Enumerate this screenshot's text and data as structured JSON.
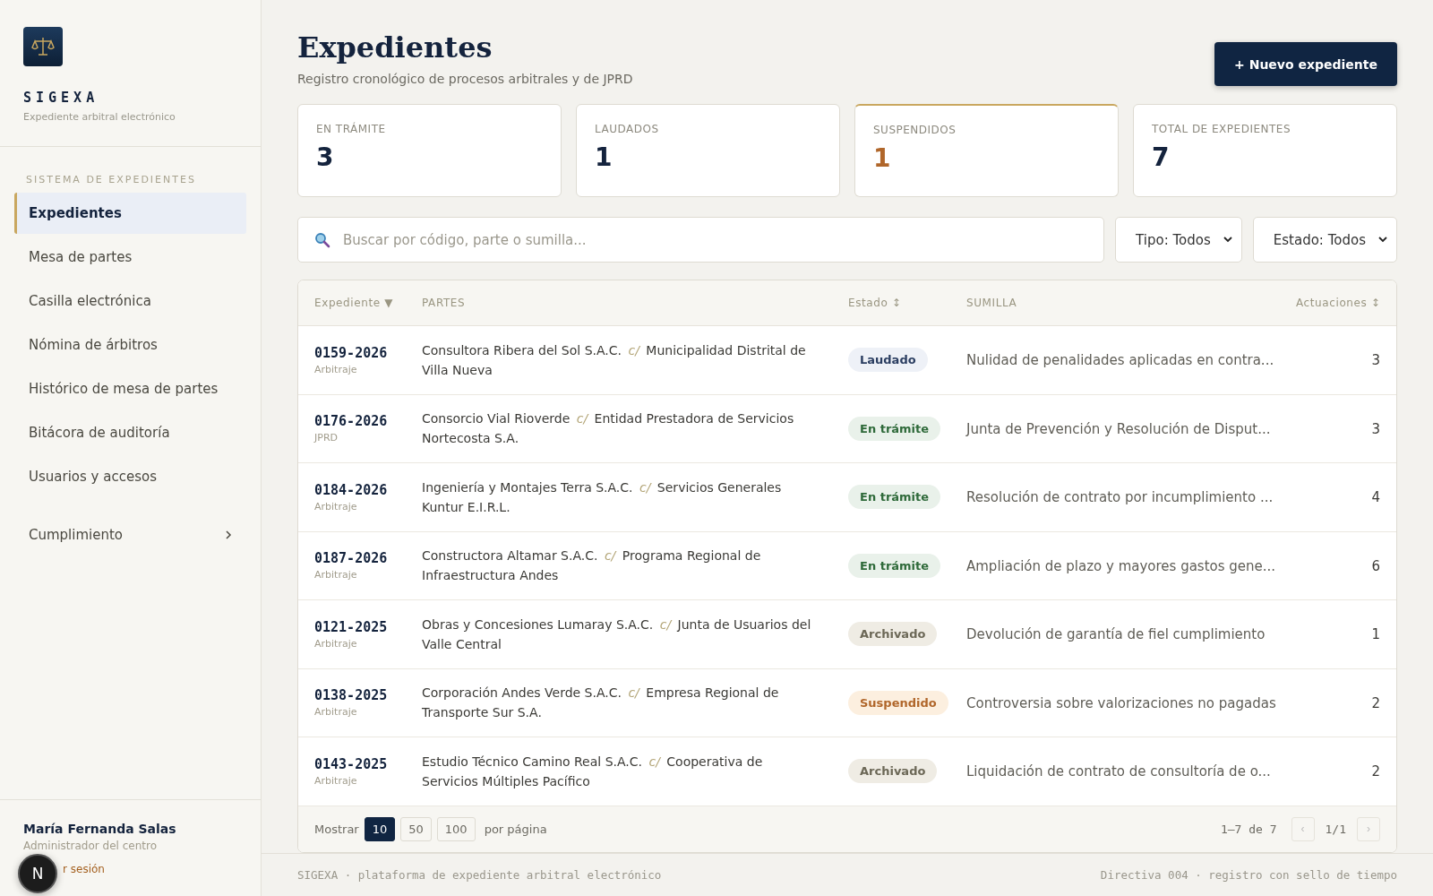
{
  "brand": {
    "name": "SIGEXA",
    "tagline": "Expediente arbitral electrónico"
  },
  "sidebar": {
    "section": "SISTEMA DE EXPEDIENTES",
    "items": [
      {
        "label": "Expedientes",
        "selected": true,
        "kind": "link"
      },
      {
        "label": "Mesa de partes",
        "selected": false,
        "kind": "link"
      },
      {
        "label": "Casilla electrónica",
        "selected": false,
        "kind": "link"
      },
      {
        "label": "Nómina de árbitros",
        "selected": false,
        "kind": "link"
      },
      {
        "label": "Histórico de mesa de partes",
        "selected": false,
        "kind": "link"
      },
      {
        "label": "Bitácora de auditoría",
        "selected": false,
        "kind": "link"
      },
      {
        "label": "Usuarios y accesos",
        "selected": false,
        "kind": "link"
      },
      {
        "label": "Cumplimiento",
        "selected": false,
        "kind": "group"
      }
    ]
  },
  "user": {
    "name": "María Fernanda Salas",
    "role": "Administrador del centro",
    "logout": "r sesión"
  },
  "dev_badge": {
    "label": "N"
  },
  "header": {
    "title": "Expedientes",
    "subtitle": "Registro cronológico de procesos arbitrales y de JPRD",
    "button": "+ Nuevo expediente"
  },
  "stats": [
    {
      "label": "EN TRÁMITE",
      "value": "3",
      "kind": "default"
    },
    {
      "label": "LAUDADOS",
      "value": "1",
      "kind": "default"
    },
    {
      "label": "SUSPENDIDOS",
      "value": "1",
      "kind": "warning"
    },
    {
      "label": "TOTAL DE EXPEDIENTES",
      "value": "7",
      "kind": "default"
    }
  ],
  "filters": {
    "search": {
      "placeholder": "Buscar por código, parte o sumilla..."
    },
    "selects": [
      "Tipo: Todos",
      "Estado: Todos"
    ]
  },
  "table": {
    "columns": [
      "Expediente ▼",
      "PARTES",
      "Estado ↕",
      "SUMILLA",
      "Actuaciones ↕"
    ],
    "rows": [
      {
        "code": "0159-2026",
        "type": "Arbitraje",
        "parties": "Consultora Ribera del Sol S.A.C. *c/* Municipalidad Distrital de Villa Nueva",
        "status": {
          "label": "Laudado",
          "kind": "laudado"
        },
        "summary": "Nulidad de penalidades aplicadas en contra...",
        "actions": "3"
      },
      {
        "code": "0176-2026",
        "type": "JPRD",
        "parties": "Consorcio Vial Rioverde *c/* Entidad Prestadora de Servicios Nortecosta S.A.",
        "status": {
          "label": "En trámite",
          "kind": "tramite"
        },
        "summary": "Junta de Prevención y Resolución de Disput...",
        "actions": "3"
      },
      {
        "code": "0184-2026",
        "type": "Arbitraje",
        "parties": "Ingeniería y Montajes Terra S.A.C. *c/* Servicios Generales Kuntur E.I.R.L.",
        "status": {
          "label": "En trámite",
          "kind": "tramite"
        },
        "summary": "Resolución de contrato por incumplimiento ...",
        "actions": "4"
      },
      {
        "code": "0187-2026",
        "type": "Arbitraje",
        "parties": "Constructora Altamar S.A.C. *c/* Programa Regional de Infraestructura Andes",
        "status": {
          "label": "En trámite",
          "kind": "tramite"
        },
        "summary": "Ampliación de plazo y mayores gastos gene...",
        "actions": "6"
      },
      {
        "code": "0121-2025",
        "type": "Arbitraje",
        "parties": "Obras y Concesiones Lumaray S.A.C. *c/* Junta de Usuarios del Valle Central",
        "status": {
          "label": "Archivado",
          "kind": "archivado"
        },
        "summary": "Devolución de garantía de fiel cumplimiento",
        "actions": "1"
      },
      {
        "code": "0138-2025",
        "type": "Arbitraje",
        "parties": "Corporación Andes Verde S.A.C. *c/* Empresa Regional de Transporte Sur S.A.",
        "status": {
          "label": "Suspendido",
          "kind": "suspendido"
        },
        "summary": "Controversia sobre valorizaciones no pagadas",
        "actions": "2"
      },
      {
        "code": "0143-2025",
        "type": "Arbitraje",
        "parties": "Estudio Técnico Camino Real S.A.C. *c/* Cooperativa de Servicios Múltiples Pacífico",
        "status": {
          "label": "Archivado",
          "kind": "archivado"
        },
        "summary": "Liquidación de contrato de consultoría de o...",
        "actions": "2"
      }
    ]
  },
  "pagination": {
    "show": "Mostrar",
    "sizes": [
      {
        "label": "10",
        "selected": true
      },
      {
        "label": "50",
        "selected": false
      },
      {
        "label": "100",
        "selected": false
      }
    ],
    "per_page": "por página",
    "range": "1–7 de 7",
    "prev": "‹",
    "page": "1/1",
    "next": "›"
  },
  "footer": {
    "left": "SIGEXA · plataforma de expediente arbitral electrónico",
    "right": "Directiva 004 · registro con sello de tiempo"
  }
}
